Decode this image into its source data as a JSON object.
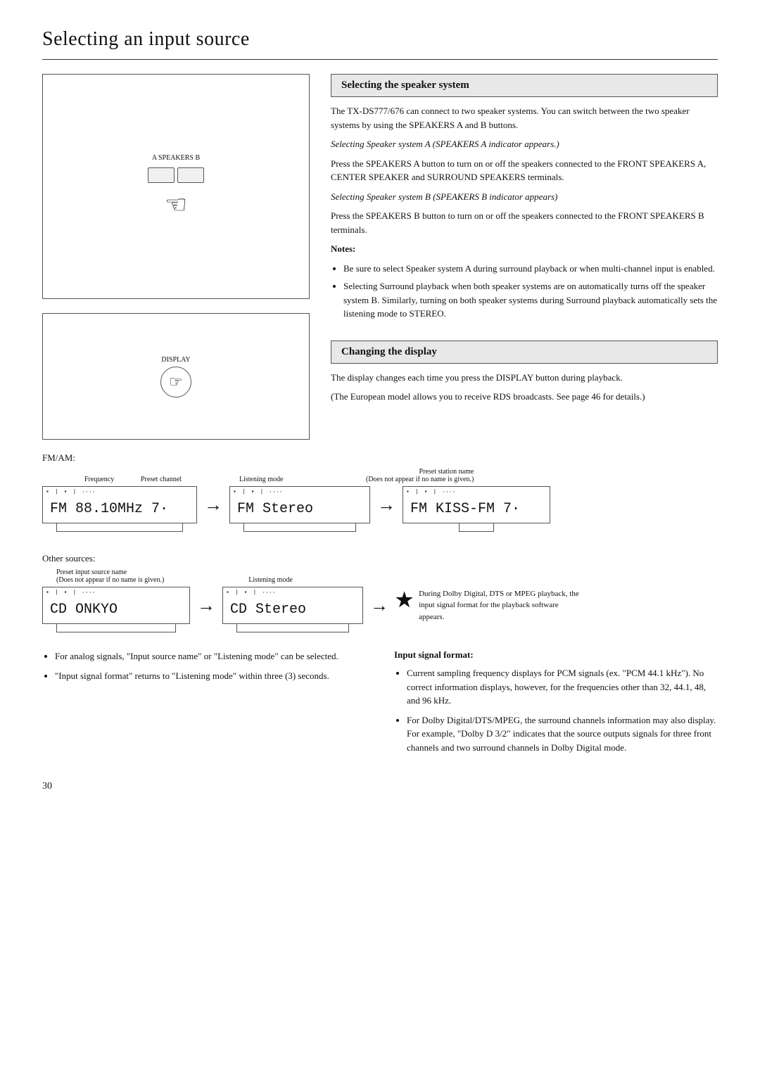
{
  "page": {
    "title": "Selecting an input source",
    "page_number": "30"
  },
  "speaker_section": {
    "heading": "Selecting the speaker system",
    "intro": "The TX-DS777/676 can connect to two speaker systems. You can switch between the two speaker systems by using the SPEAKERS A and B buttons.",
    "system_a_heading": "Selecting Speaker system A (SPEAKERS A indicator appears.)",
    "system_a_text": "Press the SPEAKERS A button to turn on or off the speakers connected to the FRONT SPEAKERS A, CENTER SPEAKER and SURROUND SPEAKERS  terminals.",
    "system_b_heading": "Selecting Speaker system B (SPEAKERS B indicator appears)",
    "system_b_text": "Press the SPEAKERS B button to turn on or off the speakers connected to the FRONT SPEAKERS B terminals.",
    "notes_label": "Notes:",
    "notes": [
      "Be sure to select Speaker system A during surround playback or when multi-channel input is enabled.",
      "Selecting Surround playback when both speaker systems are on automatically turns off the speaker system B. Similarly, turning on both speaker systems during Surround playback automatically sets the listening mode to STEREO."
    ],
    "button_label": "A SPEAKERS B"
  },
  "display_section": {
    "heading": "Changing the display",
    "intro": "The display changes each time you press the DISPLAY button during playback.",
    "european_note": "(The European model allows you to receive RDS broadcasts. See page 46 for details.)",
    "fm_am_label": "FM/AM:",
    "other_sources_label": "Other sources:",
    "fm_displays": [
      {
        "labels": {
          "freq": "Frequency",
          "preset": "Preset channel",
          "listening": "Listening mode"
        },
        "content": "FM  88.10MHz  7·"
      },
      {
        "labels": {
          "listening": "Listening mode"
        },
        "content": "FM  Stereo"
      },
      {
        "labels": {
          "station": "Preset station name",
          "note": "(Does not appear if no name is given.)"
        },
        "content": "FM KISS-FM  7·"
      }
    ],
    "cd_displays": [
      {
        "labels": {
          "source": "Preset input source name",
          "note": "(Does not appear if no name is given.)",
          "listening": "Listening mode"
        },
        "content": "CD  ONKYO"
      },
      {
        "content": "CD  Stereo"
      }
    ],
    "star_note": "★",
    "star_note_text": "During Dolby Digital, DTS or MPEG playback, the input signal format for the playback software appears."
  },
  "bottom_section": {
    "left_bullets": [
      "For analog signals, \"Input source name\" or \"Listening mode\" can be selected.",
      "\"Input signal format\" returns to \"Listening mode\" within three (3) seconds."
    ],
    "input_signal_label": "Input signal format:",
    "input_signal_bullets": [
      "Current sampling frequency displays for PCM signals (ex. \"PCM 44.1 kHz\"). No correct information displays, however, for the frequencies other than 32, 44.1, 48, and 96 kHz.",
      "For Dolby Digital/DTS/MPEG, the surround channels information may also display. For example, \"Dolby D 3/2\" indicates that the source outputs signals for three front channels and two surround channels in Dolby Digital mode."
    ]
  }
}
